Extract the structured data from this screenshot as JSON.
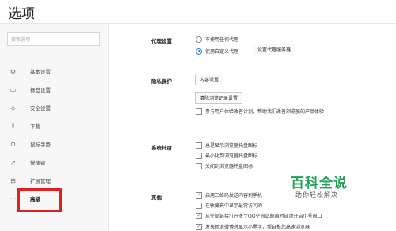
{
  "window": {
    "title": "选项"
  },
  "sidebar": {
    "search_placeholder": "搜索选项",
    "items": [
      {
        "label": "基本设置",
        "icon": "gear-icon",
        "glyph": "⚙"
      },
      {
        "label": "标签设置",
        "icon": "tab-icon",
        "glyph": "▭"
      },
      {
        "label": "安全设置",
        "icon": "shield-icon",
        "glyph": "◇"
      },
      {
        "label": "下载",
        "icon": "download-icon",
        "glyph": "⇩"
      },
      {
        "label": "鼠标手势",
        "icon": "mouse-icon",
        "glyph": "⊙"
      },
      {
        "label": "快捷键",
        "icon": "shortcut-icon",
        "glyph": "↗"
      },
      {
        "label": "扩展管理",
        "icon": "extension-icon",
        "glyph": "⊞"
      },
      {
        "label": "高级",
        "icon": "more-icon",
        "glyph": "···"
      }
    ]
  },
  "proxy": {
    "label": "代理设置",
    "options": [
      "不使用任何代理",
      "使用自定义代理"
    ],
    "button": "设置代理服务器"
  },
  "privacy": {
    "label": "隐私保护",
    "content_button": "内容设置",
    "clear_button": "清除浏览记录设置",
    "checkbox": "参与用户体验改善计划，帮助我们改善浏览器的产品体验"
  },
  "tray": {
    "label": "系统托盘",
    "options": [
      "总是显示浏览器托盘图标",
      "最小化到浏览器托盘图标",
      "关闭到浏览器托盘图标"
    ]
  },
  "other": {
    "label": "其他",
    "options": [
      "启用二维码发送内容到手机",
      "在收藏夹中显示最常访问的",
      "从外部链接打开多个QQ空间或邮箱时自动开启小号窗口",
      "发表新浪微博时显示小黑字，帮自推您高速浏览器"
    ]
  },
  "watermark": {
    "logo": "百科全说",
    "subtitle": "助你轻松解决"
  },
  "colors": {
    "accent": "#2a7de1",
    "highlight": "#e02020",
    "watermark": "#22a05a"
  }
}
